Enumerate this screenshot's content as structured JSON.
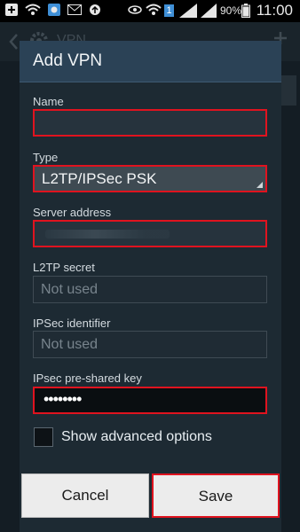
{
  "status_bar": {
    "battery_percent": "90%",
    "time": "11:00",
    "notification_count": "1"
  },
  "underlay": {
    "title": "VPN"
  },
  "dialog": {
    "title": "Add VPN",
    "fields": {
      "name": {
        "label": "Name",
        "value": ""
      },
      "type": {
        "label": "Type",
        "value": "L2TP/IPSec PSK"
      },
      "server_address": {
        "label": "Server address",
        "value": ""
      },
      "l2tp_secret": {
        "label": "L2TP secret",
        "placeholder": "Not used"
      },
      "ipsec_identifier": {
        "label": "IPSec identifier",
        "placeholder": "Not used"
      },
      "ipsec_psk": {
        "label": "IPsec pre-shared key",
        "value": "••••••••"
      }
    },
    "show_advanced": {
      "label": "Show advanced options",
      "checked": false
    },
    "buttons": {
      "cancel": "Cancel",
      "save": "Save"
    }
  },
  "colors": {
    "highlight": "#e0131f",
    "dialog_bg": "#1d2a33",
    "header_bg": "#2b4256"
  }
}
